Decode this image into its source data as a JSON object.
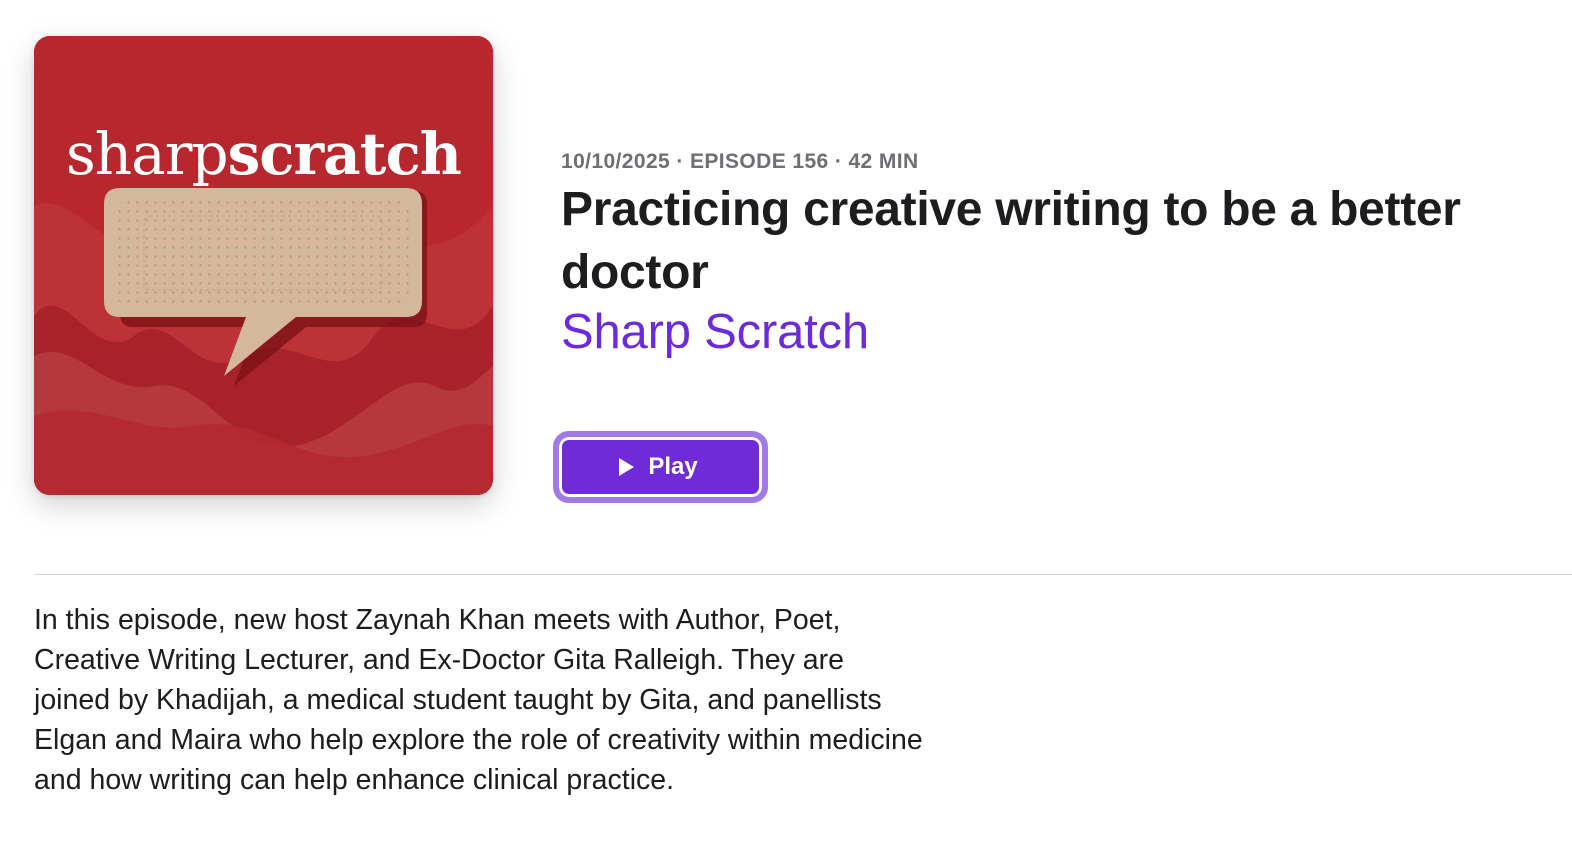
{
  "artwork": {
    "logo_light": "sharp",
    "logo_bold": "scratch",
    "background_color": "#b3262c",
    "bandage_color": "#d5b79c"
  },
  "episode": {
    "meta": "10/10/2025 · EPISODE 156 · 42 MIN",
    "title": "Practicing creative writing to be a better doctor",
    "show_name": "Sharp Scratch",
    "play_label": "Play",
    "description": "In this episode, new host Zaynah Khan meets with Author, Poet, Creative Writing Lecturer, and Ex-Doctor Gita Ralleigh. They are joined by Khadijah, a medical student taught by Gita, and panellists Elgan and Maira who help explore the role of creativity within medicine and how writing can help enhance clinical practice."
  },
  "colors": {
    "accent": "#6e2bd6",
    "accent_focus_ring": "#a27ae6",
    "show_link": "#6c2bd9",
    "meta_text": "#6e6e73"
  },
  "icons": {
    "play": "play-icon",
    "artwork": "speech-bubble-bandage-icon"
  }
}
